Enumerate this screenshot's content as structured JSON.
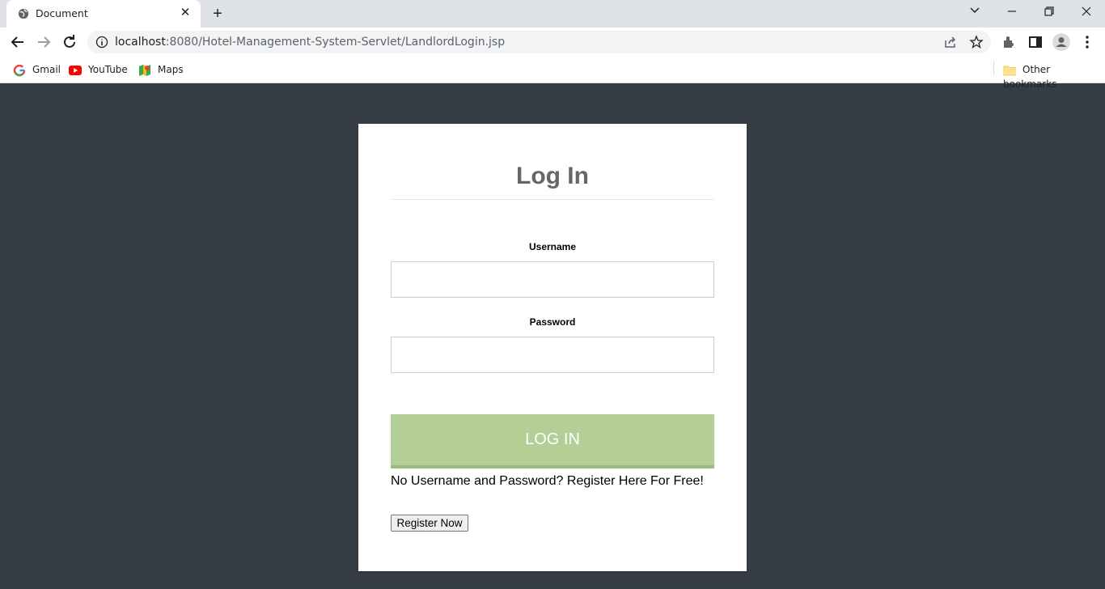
{
  "browser": {
    "tab_title": "Document",
    "url_host": "localhost",
    "url_rest": ":8080/Hotel-Management-System-Servlet/LandlordLogin.jsp",
    "bookmarks": [
      {
        "label": "Gmail",
        "icon": "google-icon"
      },
      {
        "label": "YouTube",
        "icon": "youtube-icon"
      },
      {
        "label": "Maps",
        "icon": "maps-icon"
      }
    ],
    "other_bookmarks": "Other bookmarks"
  },
  "login": {
    "title": "Log In",
    "username_label": "Username",
    "username_value": "",
    "password_label": "Password",
    "password_value": "",
    "submit_label": "LOG IN",
    "register_prompt": "No Username and Password? Register Here For Free!",
    "register_button": "Register Now"
  },
  "colors": {
    "page_bg": "#373d45",
    "card_bg": "#ffffff",
    "button_green": "#b3cf96",
    "title_gray": "#666666"
  }
}
